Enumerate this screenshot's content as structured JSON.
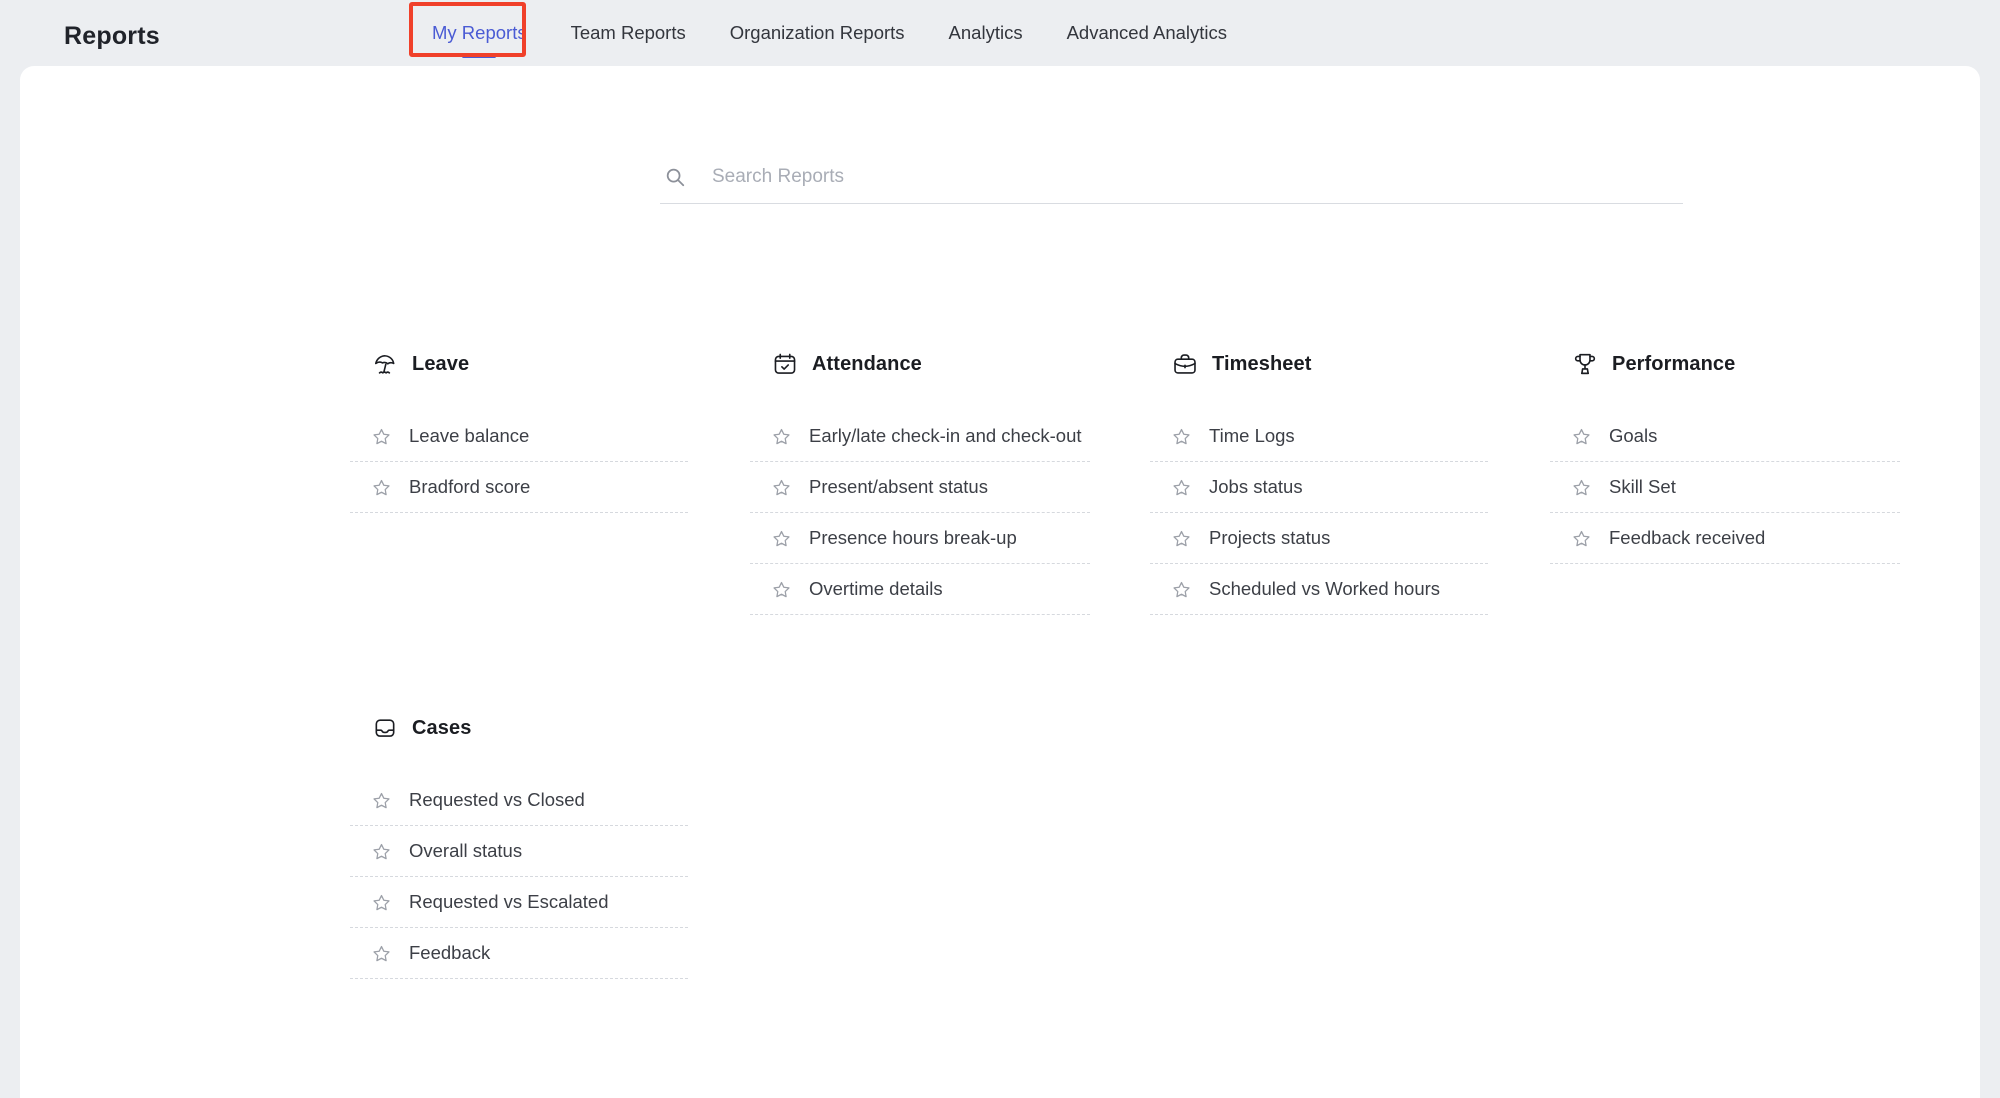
{
  "header": {
    "title": "Reports",
    "tabs": [
      {
        "label": "My Reports",
        "active": true
      },
      {
        "label": "Team Reports",
        "active": false
      },
      {
        "label": "Organization Reports",
        "active": false
      },
      {
        "label": "Analytics",
        "active": false
      },
      {
        "label": "Advanced Analytics",
        "active": false
      }
    ],
    "accent_color": "#4a5bd4",
    "annotation_color": "#f0402a"
  },
  "search": {
    "placeholder": "Search Reports",
    "value": "",
    "icon": "search-icon"
  },
  "groups": [
    {
      "title": "Leave",
      "icon": "beach-umbrella-icon",
      "items": [
        {
          "label": "Leave balance",
          "icon": "star-icon"
        },
        {
          "label": "Bradford score",
          "icon": "star-icon"
        }
      ]
    },
    {
      "title": "Attendance",
      "icon": "calendar-check-icon",
      "items": [
        {
          "label": "Early/late check-in and check-out",
          "icon": "star-icon"
        },
        {
          "label": "Present/absent status",
          "icon": "star-icon"
        },
        {
          "label": "Presence hours break-up",
          "icon": "star-icon"
        },
        {
          "label": "Overtime details",
          "icon": "star-icon"
        }
      ]
    },
    {
      "title": "Timesheet",
      "icon": "briefcase-icon",
      "items": [
        {
          "label": "Time Logs",
          "icon": "star-icon"
        },
        {
          "label": "Jobs status",
          "icon": "star-icon"
        },
        {
          "label": "Projects status",
          "icon": "star-icon"
        },
        {
          "label": "Scheduled vs Worked hours",
          "icon": "star-icon"
        }
      ]
    },
    {
      "title": "Performance",
      "icon": "trophy-icon",
      "items": [
        {
          "label": "Goals",
          "icon": "star-icon"
        },
        {
          "label": "Skill Set",
          "icon": "star-icon"
        },
        {
          "label": "Feedback received",
          "icon": "star-icon"
        }
      ]
    },
    {
      "title": "Cases",
      "icon": "inbox-tray-icon",
      "items": [
        {
          "label": "Requested vs Closed",
          "icon": "star-icon"
        },
        {
          "label": "Overall status",
          "icon": "star-icon"
        },
        {
          "label": "Requested vs Escalated",
          "icon": "star-icon"
        },
        {
          "label": "Feedback",
          "icon": "star-icon"
        }
      ]
    }
  ]
}
